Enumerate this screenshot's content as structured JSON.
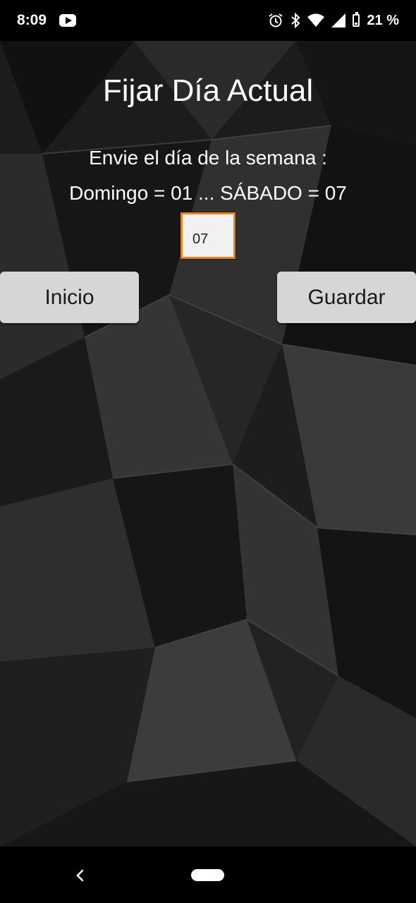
{
  "status_bar": {
    "time": "8:09",
    "notification_icon": "youtube-icon",
    "icons": [
      "alarm-icon",
      "bluetooth-icon",
      "wifi-icon",
      "signal-icon",
      "battery-icon"
    ],
    "battery_percent": "21 %",
    "battery_level": 0.21
  },
  "screen": {
    "title": "Fijar Día Actual",
    "instruction_line1": "Envie el día de la semana :",
    "instruction_line2": "Domingo = 01 ... SÁBADO = 07",
    "day_field_value": "07",
    "start_button": "Inicio",
    "save_button": "Guardar"
  },
  "navigation": {
    "back_icon": "back-chevron-icon",
    "home_icon": "home-pill-icon"
  },
  "colors": {
    "input_border": "#e8841a",
    "button_bg": "#d6d6d6",
    "background": "#1b1b1b"
  }
}
